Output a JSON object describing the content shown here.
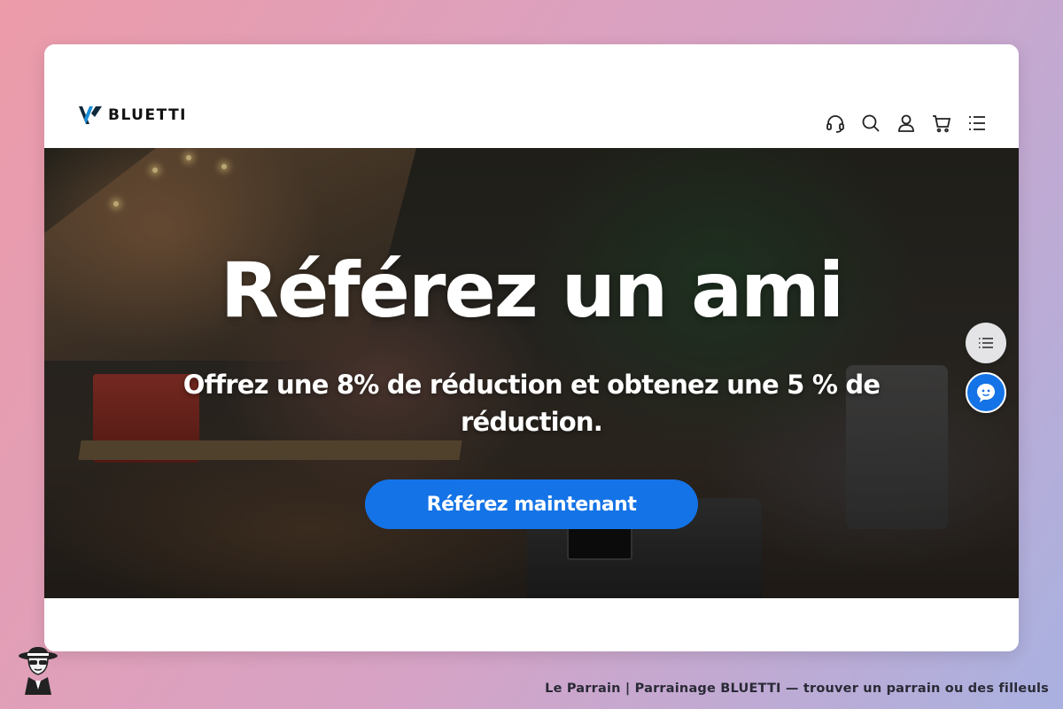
{
  "header": {
    "brand": "BLUETTI",
    "icons": [
      "headset-icon",
      "search-icon",
      "user-icon",
      "cart-icon",
      "menu-icon"
    ]
  },
  "hero": {
    "title": "Référez un ami",
    "subtitle": "Offrez une 8% de réduction et obtenez une 5 % de réduction.",
    "cta_label": "Référez maintenant"
  },
  "floating": {
    "icons": [
      "list-icon",
      "chat-icon"
    ]
  },
  "footer": {
    "caption": "Le Parrain | Parrainage BLUETTI — trouver un parrain ou des filleuls"
  },
  "colors": {
    "accent": "#1473e6",
    "background_gradient_start": "#ec9ba9",
    "background_gradient_end": "#a9b1e0",
    "brand_logo_blue": "#1a8fd8"
  }
}
